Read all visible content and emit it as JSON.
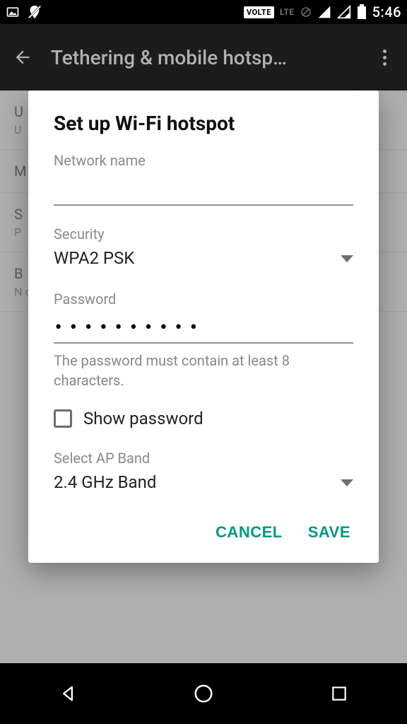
{
  "status": {
    "volte": "VOLTE",
    "lte": "LTE",
    "time": "5:46"
  },
  "appbar": {
    "title": "Tethering & mobile hotsp…"
  },
  "background": {
    "items": [
      {
        "title": "U",
        "sub": "U"
      },
      {
        "title": "M",
        "sub": ""
      },
      {
        "title": "S",
        "sub": "P"
      },
      {
        "title": "B",
        "sub": "N c"
      }
    ]
  },
  "dialog": {
    "title": "Set up Wi-Fi hotspot",
    "network_name_label": "Network name",
    "network_name_value": "",
    "security_label": "Security",
    "security_value": "WPA2 PSK",
    "password_label": "Password",
    "password_value": "••••••••••",
    "password_hint": "The password must contain at least 8 characters.",
    "show_password_label": "Show password",
    "show_password_checked": false,
    "ap_band_label": "Select AP Band",
    "ap_band_value": "2.4 GHz Band",
    "cancel": "CANCEL",
    "save": "SAVE"
  }
}
